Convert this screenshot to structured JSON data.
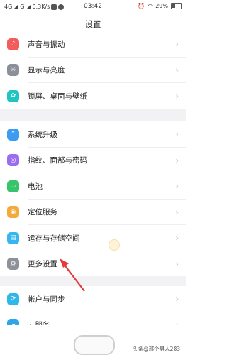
{
  "status_bar": {
    "network": "4G",
    "carrier": "G",
    "speed": "0.3K/s",
    "time": "03:42",
    "battery": "29%"
  },
  "page": {
    "title": "设置"
  },
  "groups": [
    {
      "items": [
        {
          "label": "声音与振动",
          "icon": "sound-icon",
          "color": "#f25c5c"
        },
        {
          "label": "显示与亮度",
          "icon": "brightness-icon",
          "color": "#8a8f99"
        },
        {
          "label": "锁屏、桌面与壁纸",
          "icon": "wallpaper-icon",
          "color": "#1ec5c2"
        }
      ]
    },
    {
      "items": [
        {
          "label": "系统升级",
          "icon": "system-update-icon",
          "color": "#3b9cf0"
        },
        {
          "label": "指纹、面部与密码",
          "icon": "fingerprint-icon",
          "color": "#9b6cf2"
        },
        {
          "label": "电池",
          "icon": "battery-icon",
          "color": "#38c46a"
        },
        {
          "label": "定位服务",
          "icon": "location-icon",
          "color": "#f4a93b"
        },
        {
          "label": "运存与存储空间",
          "icon": "storage-icon",
          "color": "#35b6f0"
        },
        {
          "label": "更多设置",
          "icon": "more-settings-icon",
          "color": "#8d9199"
        }
      ]
    },
    {
      "items": [
        {
          "label": "帐户与同步",
          "icon": "account-sync-icon",
          "color": "#2fb7e8"
        },
        {
          "label": "云服务",
          "icon": "cloud-icon",
          "color": "#2fa6e8"
        }
      ]
    }
  ],
  "watermark": "头条@那个男人283",
  "colors": {
    "accent_red": "#e23b3b"
  }
}
